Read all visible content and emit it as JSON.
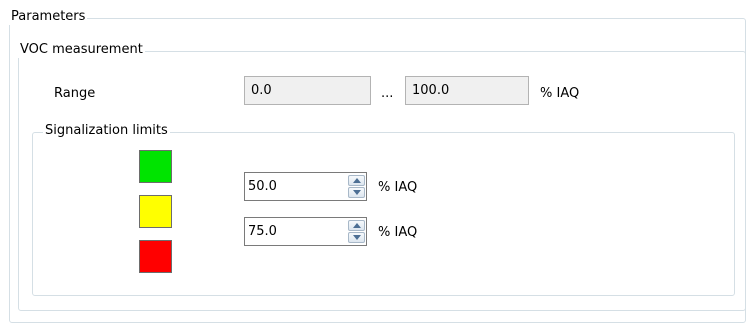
{
  "parameters_group": {
    "title": "Parameters"
  },
  "voc_group": {
    "title": "VOC measurement"
  },
  "range": {
    "label": "Range",
    "min_value": "0.0",
    "separator": "...",
    "max_value": "100.0",
    "unit": "% IAQ"
  },
  "signalization": {
    "title": "Signalization limits",
    "colors": {
      "green": "#00e400",
      "yellow": "#ffff00",
      "red": "#ff0000"
    },
    "limit1": {
      "value": "50.0",
      "unit": "% IAQ"
    },
    "limit2": {
      "value": "75.0",
      "unit": "% IAQ"
    }
  },
  "icons": {
    "spin_up": "triangle-up",
    "spin_down": "triangle-down"
  }
}
